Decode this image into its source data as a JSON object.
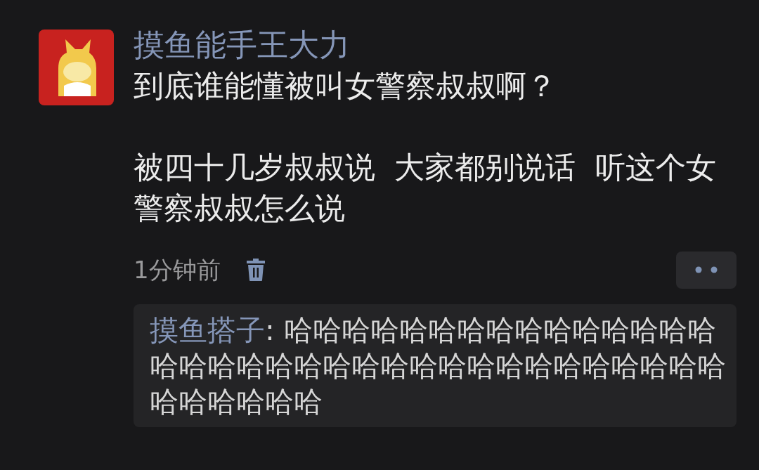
{
  "post": {
    "author": "摸鱼能手王大力",
    "paragraphs": [
      "到底谁能懂被叫女警察叔叔啊？",
      "被四十几岁叔叔说  大家都别说话  听这个女警察叔叔怎么说"
    ],
    "time": "1分钟前"
  },
  "replies": [
    {
      "author": "摸鱼搭子",
      "text": ": 哈哈哈哈哈哈哈哈哈哈哈哈哈哈哈哈哈哈哈哈哈哈哈哈哈哈哈哈哈哈哈哈哈哈哈哈哈哈哈哈哈"
    }
  ]
}
